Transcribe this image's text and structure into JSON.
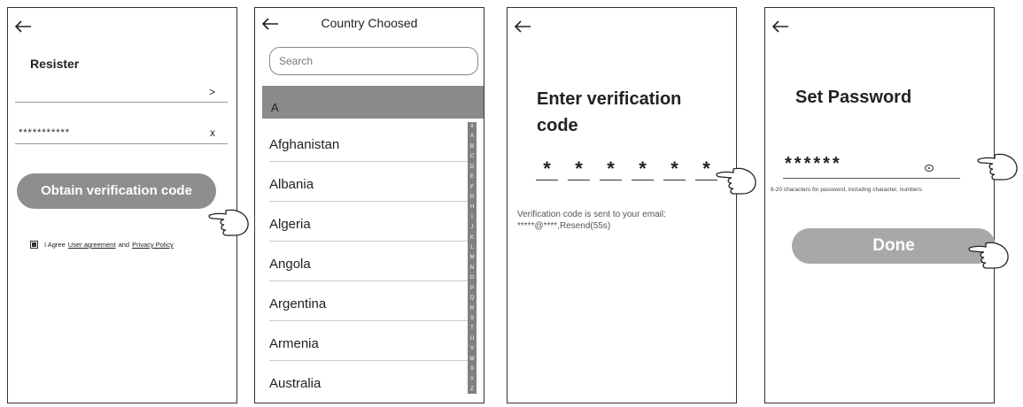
{
  "register": {
    "title": "Resister",
    "account_chevron": ">",
    "password_mask": "***********",
    "clear_label": "x",
    "obtain_button": "Obtain verification code",
    "agree_prefix": "I Agree",
    "user_agreement": "User agreement",
    "and_text": "and",
    "privacy_policy": "Privacy Policy"
  },
  "country": {
    "title": "Country Choosed",
    "search_placeholder": "Search",
    "section_header": "A",
    "countries": [
      "Afghanistan",
      "Albania",
      "Algeria",
      "Angola",
      "Argentina",
      "Armenia",
      "Australia"
    ],
    "alphabet": [
      "#",
      "A",
      "B",
      "C",
      "D",
      "E",
      "F",
      "G",
      "H",
      "I",
      "J",
      "K",
      "L",
      "M",
      "N",
      "O",
      "P",
      "Q",
      "R",
      "S",
      "T",
      "U",
      "V",
      "W",
      "X",
      "Y",
      "Z"
    ]
  },
  "verify": {
    "title": "Enter verification code",
    "code_digits": [
      "*",
      "*",
      "*",
      "*",
      "*",
      "*"
    ],
    "note_line1": "Verification code is sent to your email:",
    "note_line2": "*****@****,Resend(55s)"
  },
  "password": {
    "title": "Set Password",
    "password_mask": "******",
    "hint": "6-20 characters for password, including character, numbers",
    "done_button": "Done"
  },
  "colors": {
    "button_gray": "#8e8e8e",
    "done_gray": "#a8a8a8",
    "header_gray": "#8a8a8a"
  },
  "icons": [
    "back-arrow-icon",
    "eye-icon",
    "pointing-hand-icon",
    "checkbox-icon"
  ]
}
